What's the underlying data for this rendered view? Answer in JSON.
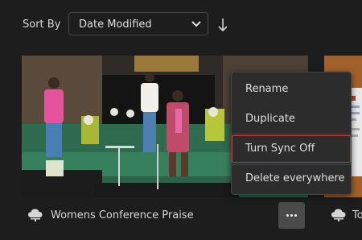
{
  "toolbar": {
    "sort_label": "Sort By",
    "sort_value": "Date Modified",
    "sort_direction_icon": "arrow-down-icon"
  },
  "files": [
    {
      "title": "Womens Conference Praise",
      "sync_icon": "cloud-sync-icon"
    },
    {
      "title": "To",
      "sync_icon": "cloud-sync-icon"
    }
  ],
  "context_menu": {
    "items": [
      "Rename",
      "Duplicate",
      "Turn Sync Off",
      "Delete everywhere"
    ],
    "highlighted": "Turn Sync Off"
  },
  "more_button_icon": "more-horizontal-icon",
  "colors": {
    "background": "#1d1d1d",
    "menu_bg": "#2c2c2c",
    "focus_outline": "#c93b3b"
  }
}
